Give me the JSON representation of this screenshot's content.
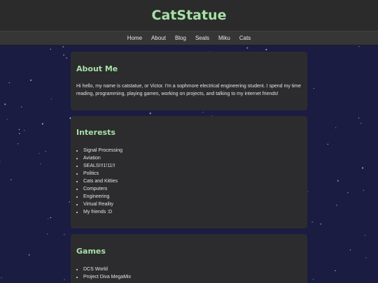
{
  "site": {
    "title": "CatStatue"
  },
  "nav": {
    "items": [
      "Home",
      "About",
      "Blog",
      "Seals",
      "Miku",
      "Cats"
    ]
  },
  "about": {
    "heading": "About Me",
    "text": "Hi hello, my name is catstatue, or Victor. I'm a sophmore electrical engineering student. I spend my time reading, programming, playing games, working on projects, and talking to my internet friends!"
  },
  "interests": {
    "heading": "Interests",
    "items": [
      "Signal Processing",
      "Aviation",
      "SEALS!!!1!11!!",
      "Politics",
      "Cats and Kitties",
      "Computers",
      "Engineering",
      "Virtual Reality",
      "My friends :D"
    ]
  },
  "games": {
    "heading": "Games",
    "items": [
      "DCS World",
      "Project Diva MegaMix"
    ]
  },
  "colors": {
    "background": "#1b1c42",
    "header": "#2b2b2b",
    "nav": "#363636",
    "card": "#2c2c2e",
    "accent": "#a6e0a6",
    "text": "#e4e4e4"
  }
}
